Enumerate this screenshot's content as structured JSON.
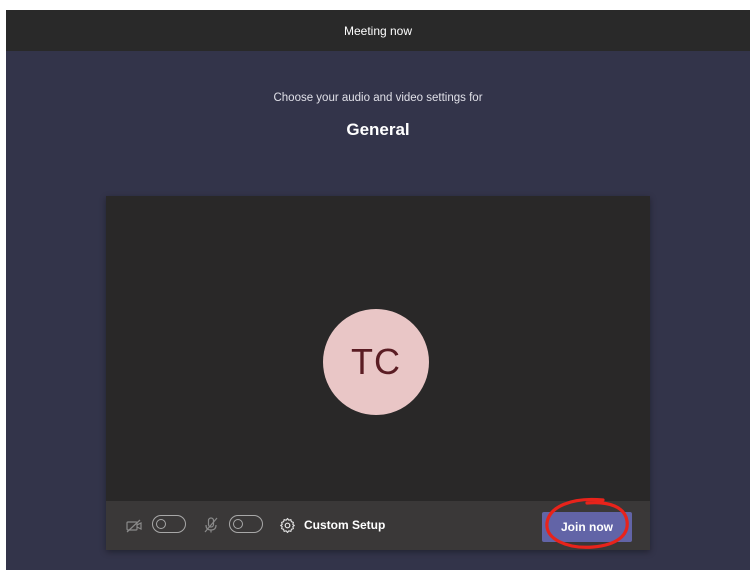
{
  "window": {
    "title": "Meeting now"
  },
  "prejoin": {
    "subtitle": "Choose your audio and video settings for",
    "channel_name": "General",
    "avatar_initials": "TC"
  },
  "controls": {
    "video_icon": "video-off-icon",
    "video_enabled": false,
    "mic_icon": "mic-off-icon",
    "mic_enabled": false,
    "settings_icon": "gear-icon",
    "custom_setup_label": "Custom Setup",
    "join_label": "Join now"
  },
  "colors": {
    "background": "#33344a",
    "titlebar": "#292929",
    "preview": "#292828",
    "controls_bar": "#3a3838",
    "avatar_bg": "#e9c6c6",
    "avatar_text": "#5a1c23",
    "join_button": "#6264a7",
    "annotation": "#e8231b"
  }
}
